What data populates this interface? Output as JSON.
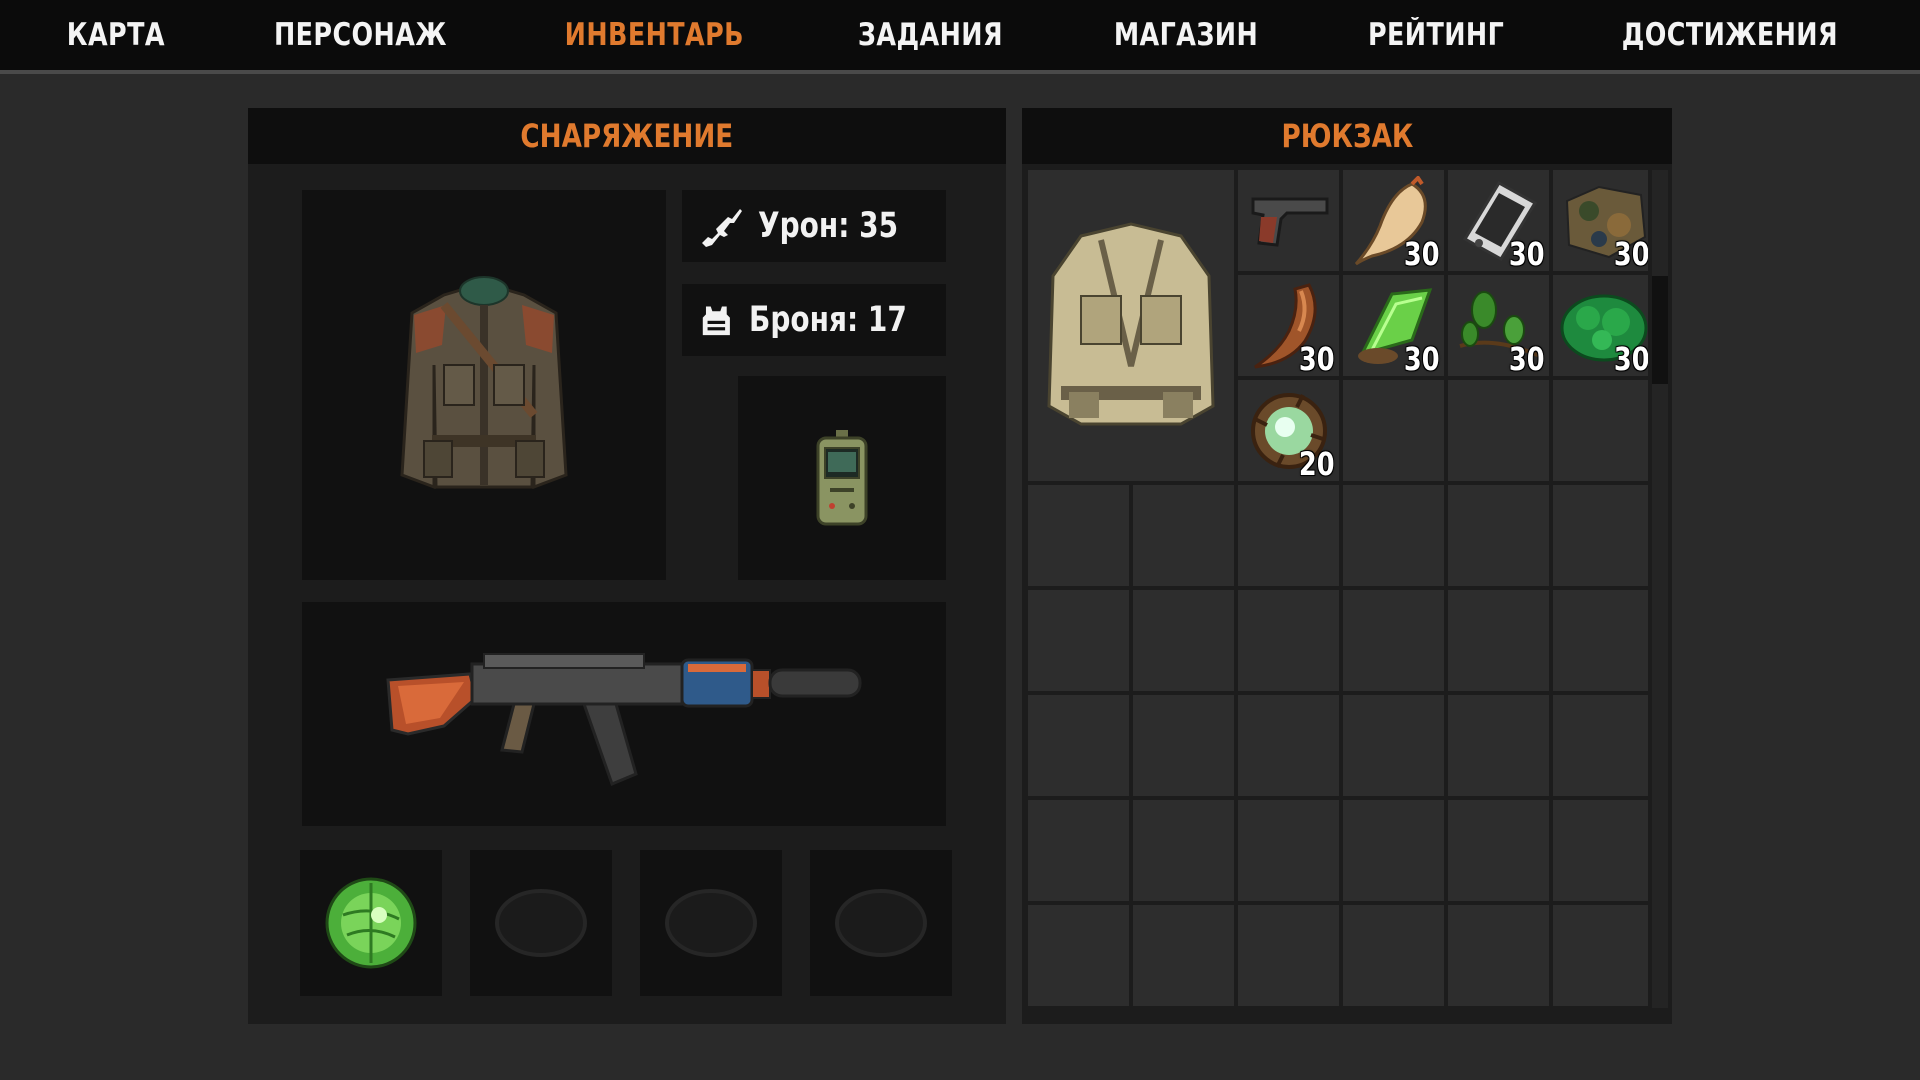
{
  "nav": {
    "items": [
      {
        "label": "КАРТА"
      },
      {
        "label": "ПЕРСОНАЖ"
      },
      {
        "label": "ИНВЕНТАРЬ",
        "active": true
      },
      {
        "label": "ЗАДАНИЯ"
      },
      {
        "label": "МАГАЗИН"
      },
      {
        "label": "РЕЙТИНГ"
      },
      {
        "label": "ДОСТИЖЕНИЯ"
      }
    ]
  },
  "equipment": {
    "title": "СНАРЯЖЕНИЕ",
    "damage_text": "Урон: 35",
    "armor_text": "Броня: 17",
    "damage_icon": "rifle-icon",
    "armor_icon": "vest-icon",
    "slots": {
      "body": "jacket-icon",
      "device": "detector-icon",
      "weapon": "assault-rifle-icon",
      "artifacts": [
        "green-artifact-icon",
        "empty-artifact-slot-icon",
        "empty-artifact-slot-icon",
        "empty-artifact-slot-icon"
      ]
    }
  },
  "backpack": {
    "title": "РЮКЗАК",
    "bag_icon": "backpack-icon",
    "items": [
      {
        "icon": "pistol-icon",
        "qty": ""
      },
      {
        "icon": "root-icon",
        "qty": "30"
      },
      {
        "icon": "pda-icon",
        "qty": "30"
      },
      {
        "icon": "camo-scrap-icon",
        "qty": "30"
      },
      {
        "icon": "claw-icon",
        "qty": "30"
      },
      {
        "icon": "crystal-plant-icon",
        "qty": "30"
      },
      {
        "icon": "herb-icon",
        "qty": "30"
      },
      {
        "icon": "moss-icon",
        "qty": "30"
      },
      {
        "icon": "nest-artifact-icon",
        "qty": "20"
      }
    ]
  },
  "colors": {
    "accent": "#e07a2e",
    "background": "#2a2a2a",
    "panel": "#1c1c1c",
    "slot": "#111111",
    "cell": "#2d2d2d"
  }
}
